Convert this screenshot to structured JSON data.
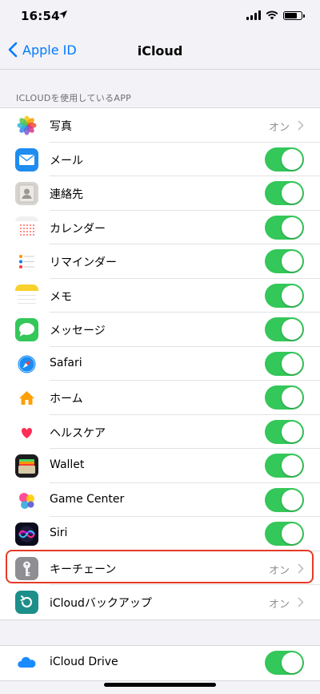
{
  "status": {
    "time": "16:54"
  },
  "nav": {
    "back_label": "Apple ID",
    "title": "iCloud"
  },
  "section": {
    "header": "ICLOUDを使用しているAPP"
  },
  "apps": [
    {
      "label": "写真",
      "icon": "photos-icon",
      "control": "value",
      "value": "オン"
    },
    {
      "label": "メール",
      "icon": "mail-icon",
      "control": "toggle",
      "on": true
    },
    {
      "label": "連絡先",
      "icon": "contacts-icon",
      "control": "toggle",
      "on": true
    },
    {
      "label": "カレンダー",
      "icon": "calendar-icon",
      "control": "toggle",
      "on": true
    },
    {
      "label": "リマインダー",
      "icon": "reminders-icon",
      "control": "toggle",
      "on": true
    },
    {
      "label": "メモ",
      "icon": "notes-icon",
      "control": "toggle",
      "on": true
    },
    {
      "label": "メッセージ",
      "icon": "messages-icon",
      "control": "toggle",
      "on": true
    },
    {
      "label": "Safari",
      "icon": "safari-icon",
      "control": "toggle",
      "on": true
    },
    {
      "label": "ホーム",
      "icon": "home-app-icon",
      "control": "toggle",
      "on": true
    },
    {
      "label": "ヘルスケア",
      "icon": "health-icon",
      "control": "toggle",
      "on": true
    },
    {
      "label": "Wallet",
      "icon": "wallet-icon",
      "control": "toggle",
      "on": true
    },
    {
      "label": "Game Center",
      "icon": "game-center-icon",
      "control": "toggle",
      "on": true
    },
    {
      "label": "Siri",
      "icon": "siri-icon",
      "control": "toggle",
      "on": true
    },
    {
      "label": "キーチェーン",
      "icon": "keychain-icon",
      "control": "value",
      "value": "オン"
    },
    {
      "label": "iCloudバックアップ",
      "icon": "icloud-backup-icon",
      "control": "value",
      "value": "オン"
    }
  ],
  "drive": {
    "label": "iCloud Drive",
    "icon": "icloud-drive-icon",
    "on": true
  },
  "colors": {
    "accent": "#007aff",
    "toggle_on": "#34c759",
    "highlight": "#e53a26"
  }
}
